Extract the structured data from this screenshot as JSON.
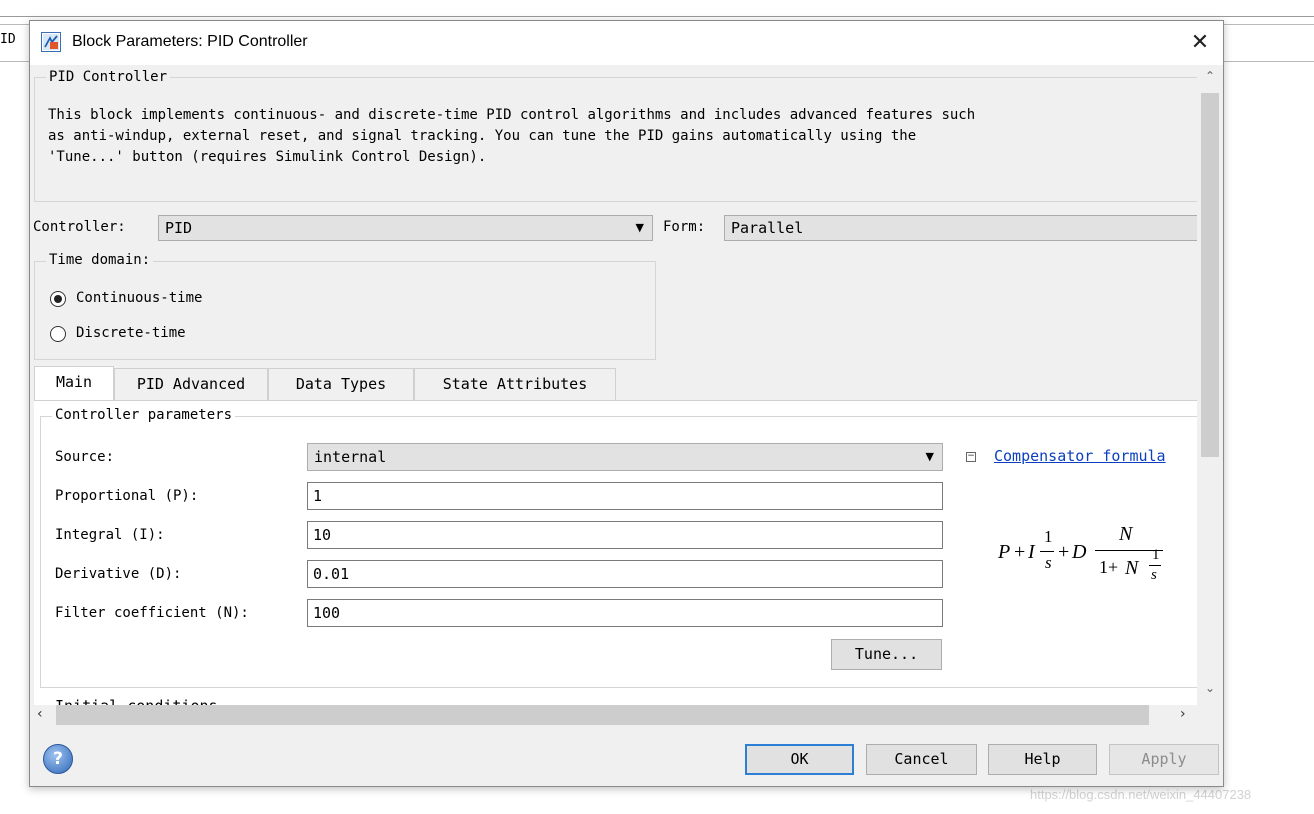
{
  "background": {
    "field_label": "ID"
  },
  "watermark": "https://blog.csdn.net/weixin_44407238",
  "dialog": {
    "title": "Block Parameters: PID Controller",
    "block_name": "PID Controller",
    "description": [
      "This block implements continuous- and discrete-time PID control algorithms and includes advanced features such",
      "as anti-windup, external reset, and signal tracking. You can tune the PID gains automatically using the",
      "'Tune...' button (requires Simulink Control Design)."
    ],
    "controller": {
      "label": "Controller:",
      "value": "PID"
    },
    "form": {
      "label": "Form:",
      "value": "Parallel"
    },
    "time_domain": {
      "label": "Time domain:",
      "options": [
        {
          "label": "Continuous-time",
          "selected": true
        },
        {
          "label": "Discrete-time",
          "selected": false
        }
      ]
    },
    "tabs": [
      {
        "label": "Main",
        "active": true
      },
      {
        "label": "PID Advanced",
        "active": false
      },
      {
        "label": "Data Types",
        "active": false
      },
      {
        "label": "State Attributes",
        "active": false
      }
    ],
    "controller_parameters": {
      "legend": "Controller parameters",
      "source": {
        "label": "Source:",
        "value": "internal"
      },
      "proportional": {
        "label": "Proportional (P):",
        "value": "1"
      },
      "integral": {
        "label": "Integral (I):",
        "value": "10"
      },
      "derivative": {
        "label": "Derivative (D):",
        "value": "0.01"
      },
      "filter": {
        "label": "Filter coefficient (N):",
        "value": "100"
      },
      "tune_button": "Tune...",
      "compensator_link": "Compensator formula"
    },
    "initial_conditions": {
      "legend": "Initial conditions"
    },
    "buttons": {
      "ok": "OK",
      "cancel": "Cancel",
      "help": "Help",
      "apply": "Apply"
    }
  }
}
